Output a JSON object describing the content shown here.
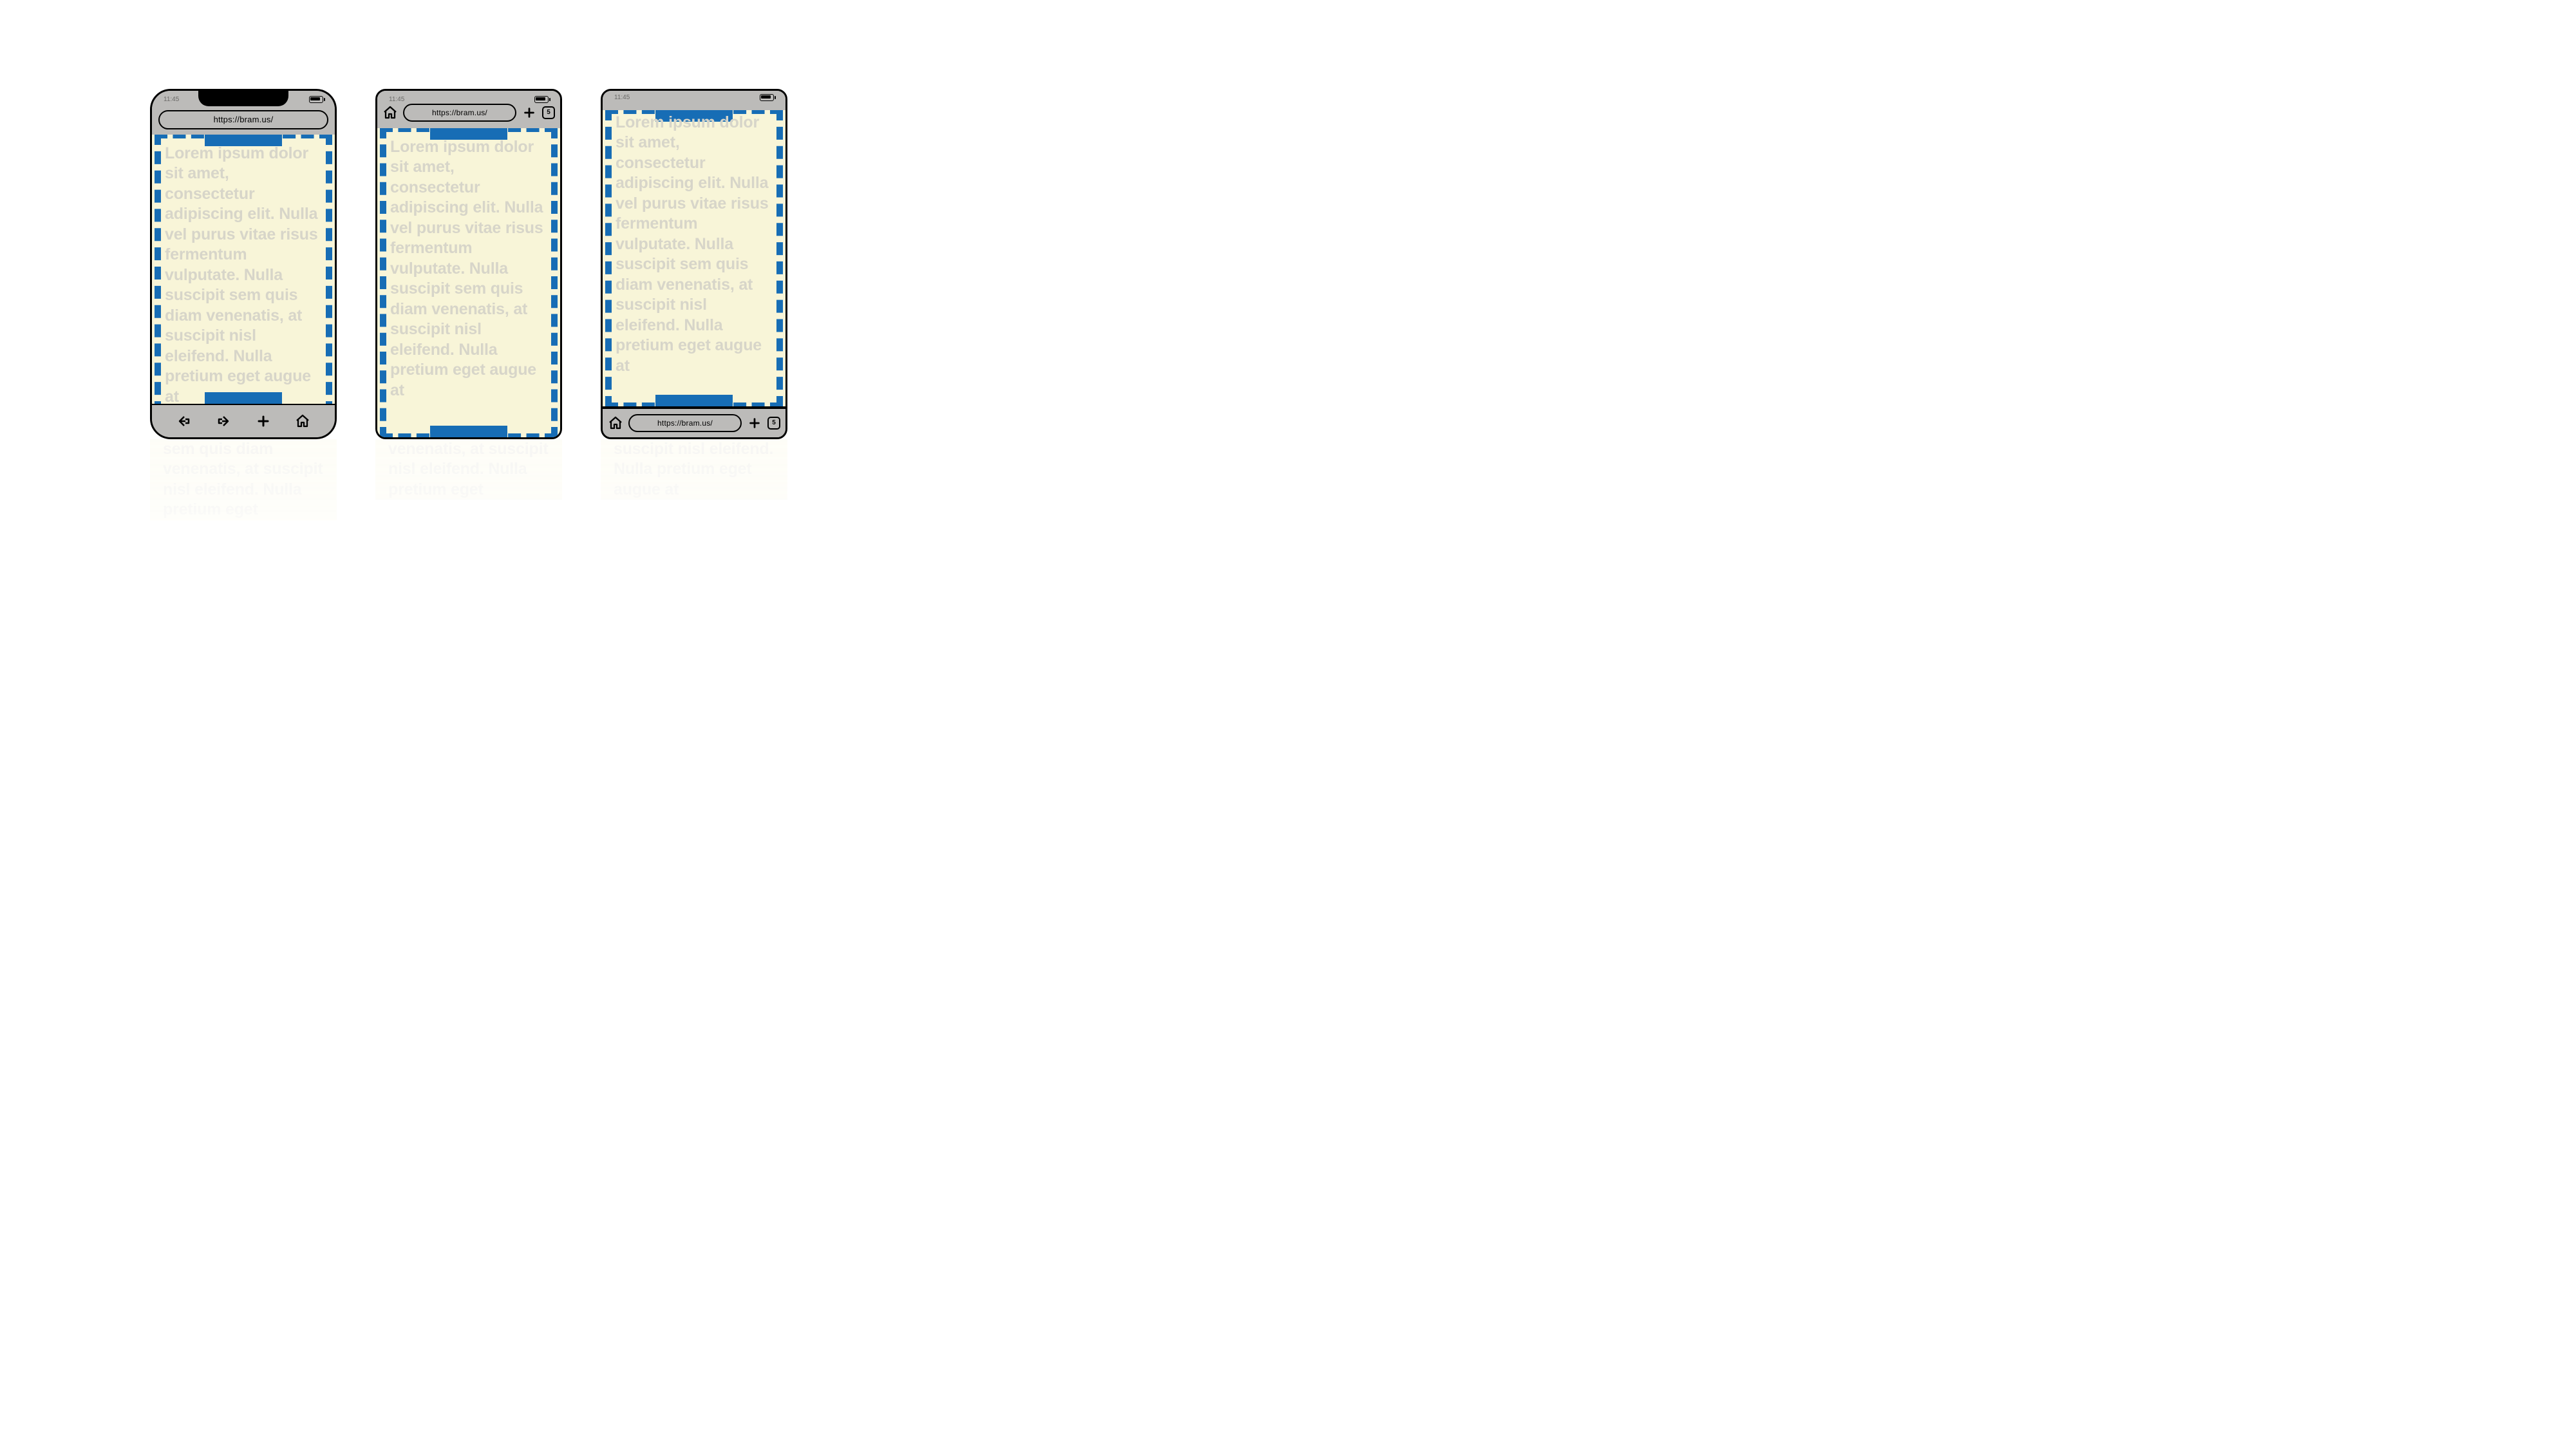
{
  "status": {
    "time": "11:45"
  },
  "url": "https://bram.us/",
  "tabs": {
    "count": "5"
  },
  "lorem": "Lorem ipsum dolor sit amet, consectetur adipiscing elit. Nulla vel purus vitae risus fermentum vulputate. Nulla suscipit sem quis diam venenatis, at suscipit nisl eleifend. Nulla pretium eget augue at",
  "reflection1": "sem quis diam venenatis, at suscipit nisl eleifend. Nulla pretium eget",
  "reflection2": "venenatis, at suscipit nisl eleifend. Nulla pretium eget",
  "reflection3": "suscipit nisl eleifend. Nulla pretium eget augue at"
}
